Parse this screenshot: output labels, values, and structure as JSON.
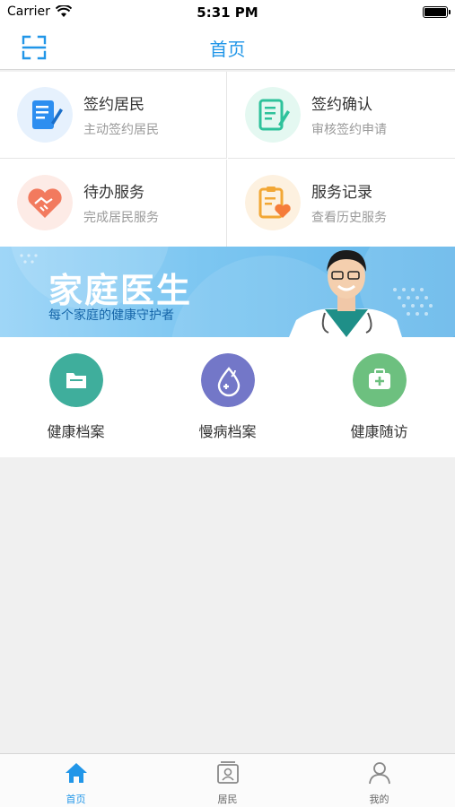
{
  "status_bar": {
    "carrier": "Carrier",
    "time": "5:31 PM"
  },
  "nav": {
    "title": "首页",
    "scan_icon": "scan-icon"
  },
  "grid": [
    {
      "title": "签约居民",
      "subtitle": "主动签约居民",
      "icon": "contract-icon",
      "color": "#2d8ef0"
    },
    {
      "title": "签约确认",
      "subtitle": "审核签约申请",
      "icon": "confirm-icon",
      "color": "#2ec29b"
    },
    {
      "title": "待办服务",
      "subtitle": "完成居民服务",
      "icon": "handshake-icon",
      "color": "#f27a5e"
    },
    {
      "title": "服务记录",
      "subtitle": "查看历史服务",
      "icon": "record-icon",
      "color": "#f2a735"
    }
  ],
  "banner": {
    "title": "家庭医生",
    "subtitle": "每个家庭的健康守护者"
  },
  "quick_actions": [
    {
      "label": "健康档案",
      "icon": "folder-icon",
      "color": "#3fae9c"
    },
    {
      "label": "慢病档案",
      "icon": "drop-icon",
      "color": "#7377c8"
    },
    {
      "label": "健康随访",
      "icon": "medkit-icon",
      "color": "#6dc07f"
    }
  ],
  "tabs": [
    {
      "label": "首页",
      "icon": "home-icon",
      "active": true
    },
    {
      "label": "居民",
      "icon": "resident-icon",
      "active": false
    },
    {
      "label": "我的",
      "icon": "user-icon",
      "active": false
    }
  ]
}
